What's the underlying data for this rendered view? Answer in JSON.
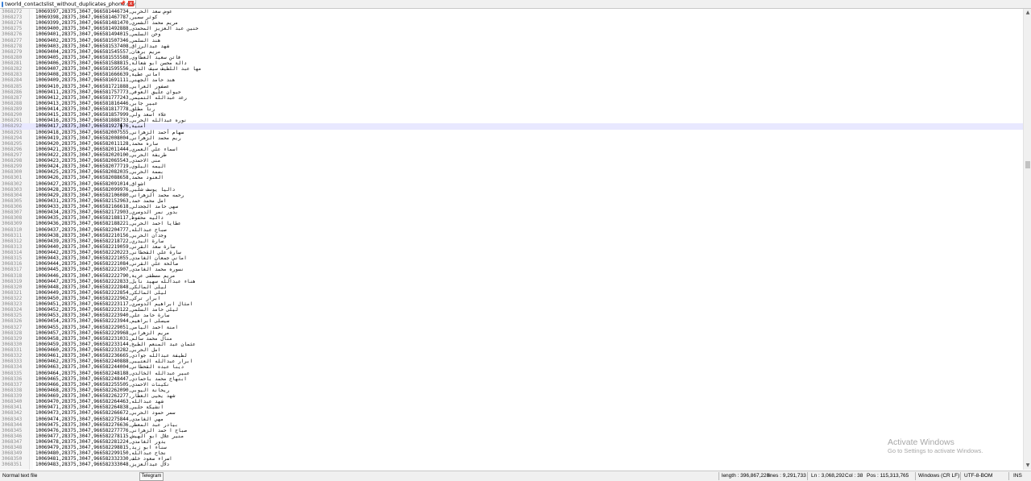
{
  "tab": {
    "label": "tworld_contactslist_without_duplicates_phone.csv",
    "close_glyph": "x",
    "pin_glyph": "📌"
  },
  "editor": {
    "current_line_number": "3068292",
    "lines": [
      {
        "n": "3068272",
        "t": "10069397,28375,3047,966581446734,عوض سعد الحربي"
      },
      {
        "n": "3068273",
        "t": "10069398,28375,3047,966581467787,كوثر سمير"
      },
      {
        "n": "3068274",
        "t": "10069399,28375,3047,966581481470,مريم محمد الشمري"
      },
      {
        "n": "3068275",
        "t": "10069400,28375,3047,966581492888,حنين عبد العزيز المحمدي"
      },
      {
        "n": "3068276",
        "t": "10069401,28375,3047,966581494015,وجن السلمي"
      },
      {
        "n": "3068277",
        "t": "10069402,28375,3047,966581507346,هند السلمي"
      },
      {
        "n": "3068278",
        "t": "10069403,28375,3047,966581537408,شهد عبدالرزاق"
      },
      {
        "n": "3068279",
        "t": "10069404,28375,3047,966581545557,مريم برهان"
      },
      {
        "n": "3068280",
        "t": "10069405,28375,3047,966581555588,فاتن سعيد العطاوي"
      },
      {
        "n": "3068281",
        "t": "10069406,28375,3047,966581588815,دالة محسن ابو شعالة"
      },
      {
        "n": "3068282",
        "t": "10069407,28375,3047,966581595556,مها عبد اللطيف سيف الدين"
      },
      {
        "n": "3068283",
        "t": "10069408,28375,3047,966581666639,اماني عطية"
      },
      {
        "n": "3068284",
        "t": "10069409,28375,3047,966581691111,هند حامد الجهني"
      },
      {
        "n": "3068285",
        "t": "10069410,28375,3047,966581721888,عصفور العرابي"
      },
      {
        "n": "3068286",
        "t": "10069411,28375,3047,966581757773,حيوان عليق العوفي"
      },
      {
        "n": "3068287",
        "t": "10069412,28375,3047,966581777243,رغد عبدالله التميمي"
      },
      {
        "n": "3068288",
        "t": "10069413,28375,3047,966581816446,عبير جابر"
      },
      {
        "n": "3068289",
        "t": "10069414,28375,3047,966581817778,رنا مطلق"
      },
      {
        "n": "3068290",
        "t": "10069415,28375,3047,966581857999,علاء اسعد ولي"
      },
      {
        "n": "3068291",
        "t": "10069416,28375,3047,966581888733,نوره عبدالله الحربي"
      },
      {
        "n": "3068292",
        "t": "10069417,28375,3047,966581927676,أمنية"
      },
      {
        "n": "3068293",
        "t": "10069418,28375,3047,966582007555,سهام أحمد الزهراني"
      },
      {
        "n": "3068294",
        "t": "10069419,28375,3047,966582008004,ريم محمد الزهراني"
      },
      {
        "n": "3068295",
        "t": "10069420,28375,3047,966582011128,ساره محمد"
      },
      {
        "n": "3068296",
        "t": "10069421,28375,3047,966582011444,اسماء علي العمري"
      },
      {
        "n": "3068297",
        "t": "10069422,28375,3047,966582020100,طريفة الحربي"
      },
      {
        "n": "3068298",
        "t": "10069423,28375,3047,966582065543,منى الاحمدي"
      },
      {
        "n": "3068299",
        "t": "10069424,28375,3047,966582077719,اليمه البلوي"
      },
      {
        "n": "3068300",
        "t": "10069425,28375,3047,966582082035,بسمة الحربي"
      },
      {
        "n": "3068301",
        "t": "10069426,28375,3047,966582088658,العنود محمد"
      },
      {
        "n": "3068302",
        "t": "10069427,28375,3047,966582091014,اشواق"
      },
      {
        "n": "3068303",
        "t": "10069428,28375,3047,966582099976,داليا يوسف شلبي"
      },
      {
        "n": "3068304",
        "t": "10069429,28375,3047,966582106080,رحمه محمد الزهراني"
      },
      {
        "n": "3068305",
        "t": "10069431,28375,3047,966582152963,امل محمد حمد"
      },
      {
        "n": "3068306",
        "t": "10069433,28375,3047,966582166618,سهى حامد الجحدلي"
      },
      {
        "n": "3068307",
        "t": "10069434,28375,3047,966582172903,بدور نمر الدوسري"
      },
      {
        "n": "3068308",
        "t": "10069435,28375,3047,966582188117,داليه محفوظ"
      },
      {
        "n": "3068309",
        "t": "10069436,28375,3047,966582188221,عطايا احمد الحربي"
      },
      {
        "n": "3068310",
        "t": "10069437,28375,3047,966582204777,صباح عبدالله"
      },
      {
        "n": "3068311",
        "t": "10069438,28375,3047,966582210156,وجدان الحربي"
      },
      {
        "n": "3068312",
        "t": "10069439,28375,3047,966582218722,سارة البدري"
      },
      {
        "n": "3068313",
        "t": "10069440,28375,3047,966582219059,سارة سعد القرني"
      },
      {
        "n": "3068314",
        "t": "10069442,28375,3047,966582220223,سارة علي القحطاني"
      },
      {
        "n": "3068315",
        "t": "10069443,28375,3047,966582221055,اماني جمعان الغامدي"
      },
      {
        "n": "3068316",
        "t": "10069444,28375,3047,966582221084,صالحة علي القرني"
      },
      {
        "n": "3068317",
        "t": "10069445,28375,3047,966582221907,نسوره محمد الغامدي"
      },
      {
        "n": "3068318",
        "t": "10069446,28375,3047,966582222790,مريم مصطفى عرية"
      },
      {
        "n": "3068319",
        "t": "10069447,28375,3047,966582222833,هناء عبدالله سهيد نابل"
      },
      {
        "n": "3068320",
        "t": "10069448,28375,3047,966582222848,ليلى المالكي"
      },
      {
        "n": "3068321",
        "t": "10069449,28375,3047,966582222854,ليلى المالكي"
      },
      {
        "n": "3068322",
        "t": "10069450,28375,3047,966582222962,ابرار تركي"
      },
      {
        "n": "3068323",
        "t": "10069451,28375,3047,966582223117,امثال ابراهيم الدوسري"
      },
      {
        "n": "3068324",
        "t": "10069452,28375,3047,966582223122,ليلى حامد السلمي"
      },
      {
        "n": "3068325",
        "t": "10069453,28375,3047,966582223940,سارة حامد علي"
      },
      {
        "n": "3068326",
        "t": "10069454,28375,3047,966582223944,سيسلى ابراهيم"
      },
      {
        "n": "3068327",
        "t": "10069455,28375,3047,966582229051,امنة احمد اليامي"
      },
      {
        "n": "3068328",
        "t": "10069457,28375,3047,966582229968,مريم الزهراني"
      },
      {
        "n": "3068329",
        "t": "10069458,28375,3047,966582231031,منال محمد سالم"
      },
      {
        "n": "3068330",
        "t": "10069459,28375,3047,966582233144,عثمان عبد المنعم الطبخ"
      },
      {
        "n": "3068331",
        "t": "10069460,28375,3047,966582233282,امل الحربي"
      },
      {
        "n": "3068332",
        "t": "10069461,28375,3047,966582236665,لطيفة عبدالله جوادي"
      },
      {
        "n": "3068333",
        "t": "10069462,28375,3047,966582240888,ابرار عبدالله العتيبي"
      },
      {
        "n": "3068334",
        "t": "10069463,28375,3047,966582244004,دينا عبده القحطاني"
      },
      {
        "n": "3068335",
        "t": "10069464,28375,3047,966582248188,عبير عبدالله الخالدي"
      },
      {
        "n": "3068336",
        "t": "10069465,28375,3047,966582248447,ابتهاج محمد باحمادي"
      },
      {
        "n": "3068337",
        "t": "10069466,28375,3047,966582255505,نكينات الاحمدي"
      },
      {
        "n": "3068338",
        "t": "10069468,28375,3047,966582262090,ريحانة اليوبي"
      },
      {
        "n": "3068339",
        "t": "10069469,28375,3047,966582262277,شهد يحيى العطار"
      },
      {
        "n": "3068340",
        "t": "10069470,28375,3047,966582264463,شهد عبدالله"
      },
      {
        "n": "3068341",
        "t": "10069471,28375,3047,966582264838,انشيكة حلبي"
      },
      {
        "n": "3068342",
        "t": "10069473,28375,3047,966582266672,سمر حمود الحربي"
      },
      {
        "n": "3068343",
        "t": "10069474,28375,3047,966582275844,مهي الغامدي"
      },
      {
        "n": "3068344",
        "t": "10069475,28375,3047,966582276636,بيادر عبد المعطي"
      },
      {
        "n": "3068345",
        "t": "10069476,28375,3047,966582277776,صباح ا حمد الزهراني"
      },
      {
        "n": "3068346",
        "t": "10069477,28375,3047,966582278115,منير علال ابو الهيش"
      },
      {
        "n": "3068347",
        "t": "10069478,28375,3047,966582281224,بدور الغامدي"
      },
      {
        "n": "3068348",
        "t": "10069479,28375,3047,966582298815,سناء ابو زيد"
      },
      {
        "n": "3068349",
        "t": "10069480,28375,3047,966582299150,نجاح عبدالله"
      },
      {
        "n": "3068350",
        "t": "10069481,28375,3047,966582332330,اسراء سعود خلف"
      },
      {
        "n": "3068351",
        "t": "10069483,28375,3047,966582333048,دلال عبدالعزيز"
      }
    ]
  },
  "watermark": {
    "title": "Activate Windows",
    "subtitle": "Go to Settings to activate Windows."
  },
  "statusbar": {
    "file_type": "Normal text file",
    "taskbar_button": "Telegram",
    "length": "length : 396,867,220",
    "lines": "lines : 9,291,733",
    "ln": "Ln : 3,068,292",
    "col": "Col : 38",
    "pos": "Pos : 115,313,765",
    "eol": "Windows (CR LF)",
    "encoding": "UTF-8-BOM",
    "mode": "INS"
  },
  "scrollbar": {
    "up_glyph": "▲",
    "down_glyph": "▼",
    "position_fraction": 0.33
  },
  "colors": {
    "current_line": "#e8e8ff",
    "line_numbers": "#8a8a8a",
    "tab_close": "#e03c31",
    "watermark": "#a7a7a7"
  }
}
